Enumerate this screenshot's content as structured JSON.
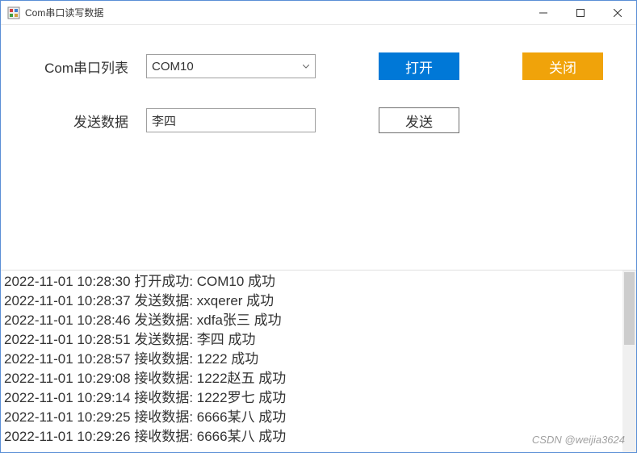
{
  "window": {
    "title": "Com串口读写数据"
  },
  "form": {
    "com_list_label": "Com串口列表",
    "com_selected": "COM10",
    "open_label": "打开",
    "close_label": "关闭",
    "send_data_label": "发送数据",
    "send_data_value": "李四",
    "send_button_label": "发送"
  },
  "colors": {
    "primary": "#0078d7",
    "warning": "#f0a30a"
  },
  "log": [
    "2022-11-01 10:28:30 打开成功: COM10 成功",
    "2022-11-01 10:28:37 发送数据: xxqerer 成功",
    "2022-11-01 10:28:46 发送数据: xdfa张三 成功",
    "2022-11-01 10:28:51 发送数据: 李四 成功",
    "2022-11-01 10:28:57 接收数据: 1222 成功",
    "2022-11-01 10:29:08 接收数据: 1222赵五 成功",
    "2022-11-01 10:29:14 接收数据: 1222罗七 成功",
    "2022-11-01 10:29:25 接收数据: 6666某八 成功",
    "2022-11-01 10:29:26 接收数据: 6666某八 成功"
  ],
  "watermark": "CSDN @weijia3624"
}
